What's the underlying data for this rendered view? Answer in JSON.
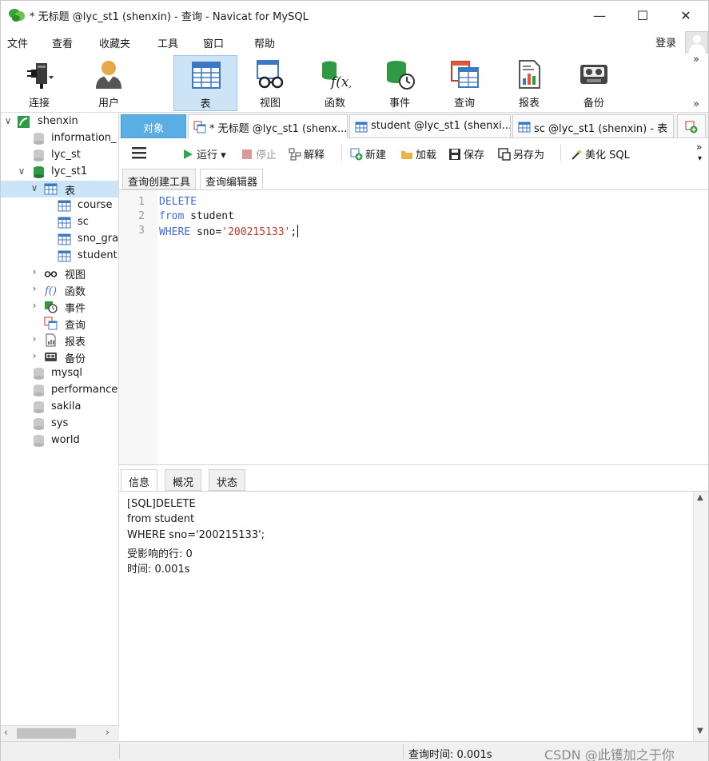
{
  "window": {
    "title": "* 无标题 @lyc_st1 (shenxin) - 查询 - Navicat for MySQL",
    "minimize": "—",
    "maximize": "☐",
    "close": "✕"
  },
  "menu": {
    "items": [
      "文件",
      "查看",
      "收藏夹",
      "工具",
      "窗口",
      "帮助"
    ],
    "login": "登录"
  },
  "toolbar": {
    "buttons": [
      {
        "label": "连接",
        "icon": "plug-icon"
      },
      {
        "label": "用户",
        "icon": "user-icon"
      },
      {
        "label": "表",
        "icon": "table-icon",
        "active": true
      },
      {
        "label": "视图",
        "icon": "view-glasses-icon"
      },
      {
        "label": "函数",
        "icon": "function-icon"
      },
      {
        "label": "事件",
        "icon": "event-clock-icon"
      },
      {
        "label": "查询",
        "icon": "query-icon"
      },
      {
        "label": "报表",
        "icon": "report-icon"
      },
      {
        "label": "备份",
        "icon": "backup-tape-icon"
      }
    ],
    "more": "»"
  },
  "tree": {
    "connection": "shenxin",
    "databases_top": [
      "information_",
      "lyc_st"
    ],
    "current_db": "lyc_st1",
    "tables_node": "表",
    "tables": [
      "course",
      "sc",
      "sno_gra",
      "student"
    ],
    "other_nodes": [
      {
        "label": "视图",
        "icon": "view-glasses-icon"
      },
      {
        "label": "函数",
        "icon": "function-icon"
      },
      {
        "label": "事件",
        "icon": "event-clock-icon"
      },
      {
        "label": "查询",
        "icon": "query-icon"
      },
      {
        "label": "报表",
        "icon": "report-icon"
      },
      {
        "label": "备份",
        "icon": "backup-tape-icon"
      }
    ],
    "databases_bottom": [
      "mysql",
      "performance",
      "sakila",
      "sys",
      "world"
    ]
  },
  "tabs": {
    "objects": "对象",
    "items": [
      "* 无标题 @lyc_st1 (shenx...",
      "student @lyc_st1 (shenxi...",
      "sc @lyc_st1 (shenxin) - 表"
    ]
  },
  "query_toolbar": {
    "run": "运行",
    "stop": "停止",
    "explain": "解释",
    "new": "新建",
    "load": "加载",
    "save": "保存",
    "save_as": "另存为",
    "beautify": "美化 SQL"
  },
  "subtabs": [
    "查询创建工具",
    "查询编辑器"
  ],
  "editor": {
    "line_numbers": [
      "1",
      "2",
      "3"
    ],
    "line1_kw": "DELETE",
    "line2_kw": "from",
    "line2_rest": " student",
    "line3_kw": "WHERE",
    "line3_mid": " sno=",
    "line3_str": "'200215133'",
    "line3_end": ";"
  },
  "result": {
    "tabs": [
      "信息",
      "概况",
      "状态"
    ],
    "messages": [
      "[SQL]DELETE",
      "from student",
      "WHERE sno='200215133';",
      "受影响的行: 0",
      "时间: 0.001s"
    ]
  },
  "status": {
    "query_time": "查询时间: 0.001s",
    "watermark": "CSDN @此镬加之于你"
  },
  "colors": {
    "accent": "#5aaee3",
    "selected": "#cce4f7",
    "keyword": "#4169e1",
    "string": "#c0392b"
  }
}
